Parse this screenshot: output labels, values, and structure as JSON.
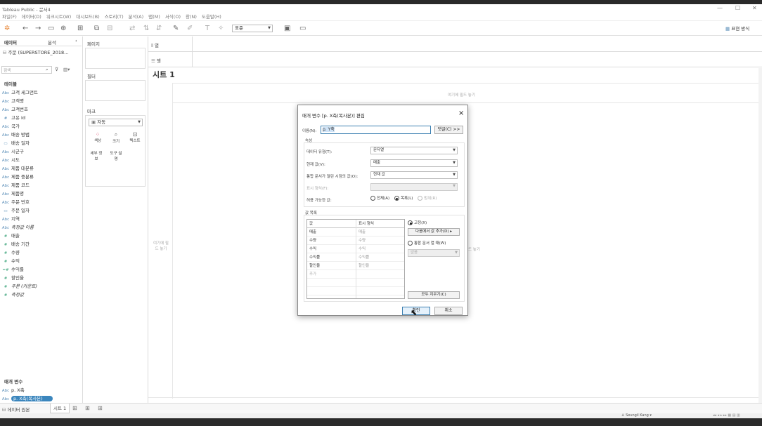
{
  "app": {
    "title": "Tableau Public - 문서4",
    "menus": [
      "파일(F)",
      "데이터(D)",
      "워크시트(W)",
      "대시보드(B)",
      "스토리(T)",
      "분석(A)",
      "맵(M)",
      "서식(O)",
      "창(N)",
      "도움말(H)"
    ],
    "window_controls": [
      "—",
      "☐",
      "✕"
    ]
  },
  "toolbar": {
    "standard_label": "표준",
    "show_me": "표현 방식"
  },
  "datapane": {
    "tab_data": "데이터",
    "tab_analysis": "분석",
    "datasource": "주문 (SUPERSTORE_2018...",
    "search_placeholder": "검색",
    "tables_header": "테이블",
    "dimensions": [
      {
        "type": "Abc",
        "name": "고객 세그먼트"
      },
      {
        "type": "Abc",
        "name": "고객명"
      },
      {
        "type": "Abc",
        "name": "고객번호"
      },
      {
        "type": "#",
        "name": "고유 Id"
      },
      {
        "type": "Abc",
        "name": "국가"
      },
      {
        "type": "Abc",
        "name": "배송 방법"
      },
      {
        "type": "▭",
        "name": "배송 일자"
      },
      {
        "type": "Abc",
        "name": "시군구"
      },
      {
        "type": "Abc",
        "name": "시도"
      },
      {
        "type": "Abc",
        "name": "제품 대분류"
      },
      {
        "type": "Abc",
        "name": "제품 중분류"
      },
      {
        "type": "Abc",
        "name": "제품 코드"
      },
      {
        "type": "Abc",
        "name": "제품명"
      },
      {
        "type": "Abc",
        "name": "주문 번호"
      },
      {
        "type": "▭",
        "name": "주문 일자"
      },
      {
        "type": "Abc",
        "name": "지역"
      },
      {
        "type": "Abc",
        "name": "측정값 이름",
        "italic": true
      }
    ],
    "measures": [
      {
        "type": "#",
        "name": "매출"
      },
      {
        "type": "#",
        "name": "배송 기간"
      },
      {
        "type": "#",
        "name": "수량"
      },
      {
        "type": "#",
        "name": "수익"
      },
      {
        "type": "=#",
        "name": "수익률"
      },
      {
        "type": "#",
        "name": "할인율"
      },
      {
        "type": "#",
        "name": "주문 (카운트)",
        "italic": true
      },
      {
        "type": "#",
        "name": "측정값",
        "italic": true
      }
    ],
    "params_header": "매개 변수",
    "params": [
      {
        "type": "Abc",
        "name": "p. X축"
      },
      {
        "type": "Abc",
        "name": "p. X축(복사본)"
      }
    ]
  },
  "shelves": {
    "pages": "페이지",
    "filters": "필터",
    "marks": "마크",
    "marks_type": "자동",
    "mark_buttons": [
      "색상",
      "크기",
      "텍스트",
      "세부 정보",
      "도구 설명"
    ],
    "columns": "열",
    "rows": "행"
  },
  "sheet": {
    "title": "시트 1",
    "drop_top": "여기에 필드 놓기",
    "drop_left": "여기에 필드 놓기",
    "drop_right": "드 놓기"
  },
  "dialog": {
    "title": "매개 변수 [p. X축(복사본)] 편집",
    "name_label": "이름(N):",
    "name_value": "p. Y축",
    "comment_btn": "댓글(C) >>",
    "props_label": "속성",
    "datatype_label": "데이터 유형(T):",
    "datatype_value": "문자열",
    "current_label": "현재 값(V):",
    "current_value": "매출",
    "workbook_label": "통합 문서가 열린 시점의 값(O):",
    "workbook_value": "현재 값",
    "format_label": "표시 형식(F):",
    "allowable_label": "허용 가능한 값:",
    "opt_all": "전체(A)",
    "opt_list": "목록(L)",
    "opt_range": "범위(R)",
    "list_label": "값 목록",
    "col_value": "값",
    "col_display": "표시 형식",
    "rows": [
      {
        "v": "매출",
        "d": "매출"
      },
      {
        "v": "수량",
        "d": "수량"
      },
      {
        "v": "수익",
        "d": "수익"
      },
      {
        "v": "수익률",
        "d": "수익률"
      },
      {
        "v": "할인율",
        "d": "할인율"
      },
      {
        "v": "추가",
        "d": ""
      }
    ],
    "opt_fixed": "고정(X)",
    "add_from": "다음에서 값 추가(D)",
    "opt_workbook_open": "통합 문서 열 때(W)",
    "workbook_open_value": "없음",
    "clear_all": "모두 지우기(C)",
    "ok": "확인",
    "cancel": "취소"
  },
  "statusbar": {
    "datasource_tab": "데이터 원본",
    "sheet_tab": "시트 1",
    "user": "Seungil Kang"
  }
}
